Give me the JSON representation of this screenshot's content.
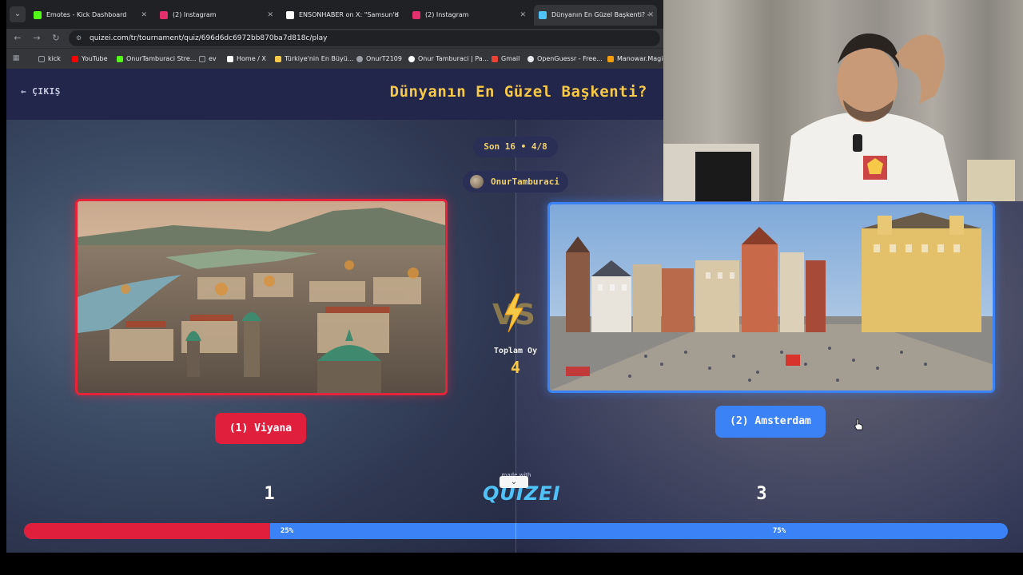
{
  "browser": {
    "tabs": [
      {
        "title": "Emotes - Kick Dashboard",
        "color": "#53fc18"
      },
      {
        "title": "(2) Instagram",
        "color": "#e1306c"
      },
      {
        "title": "ENSONHABER on X: \"Samsun'd",
        "color": "#ffffff"
      },
      {
        "title": "(2) Instagram",
        "color": "#e1306c"
      },
      {
        "title": "Dünyanın En Güzel Başkenti? -",
        "color": "#4fc3f7"
      }
    ],
    "url": "quizei.com/tr/tournament/quiz/696d6dc6972bb870ba7d818c/play",
    "bookmarks": [
      {
        "label": "kick",
        "color": "#9aa0a6"
      },
      {
        "label": "YouTube",
        "color": "#ff0000"
      },
      {
        "label": "OnurTamburaci Stre...",
        "color": "#53fc18"
      },
      {
        "label": "ev",
        "color": "#9aa0a6"
      },
      {
        "label": "Home / X",
        "color": "#ffffff"
      },
      {
        "label": "Türkiye'nin En Büyü...",
        "color": "#f7c948"
      },
      {
        "label": "OnurT2109",
        "color": "#9aa0a6"
      },
      {
        "label": "Onur Tamburaci | Pa...",
        "color": "#ffffff"
      },
      {
        "label": "Gmail",
        "color": "#ea4335"
      },
      {
        "label": "OpenGuessr - Free...",
        "color": "#e8eaed"
      },
      {
        "label": "Manowar.Magic",
        "color": "#f59e0b"
      }
    ]
  },
  "header": {
    "exit_label": "ÇIKIŞ",
    "title": "Dünyanın En Güzel Başkenti?"
  },
  "round": {
    "label": "Son 16 • 4/8",
    "user": "OnurTamburaci"
  },
  "vs": {
    "total_label": "Toplam Oy",
    "total_value": "4"
  },
  "options": {
    "left": {
      "label": "(1) Viyana",
      "votes": "1",
      "percent_label": "25%",
      "percent": 25,
      "color": "#e01f3d"
    },
    "right": {
      "label": "(2) Amsterdam",
      "votes": "3",
      "percent_label": "75%",
      "percent": 75,
      "color": "#3b82f6"
    }
  },
  "logo": {
    "small_text": "made with",
    "text": "QUIZEI"
  }
}
